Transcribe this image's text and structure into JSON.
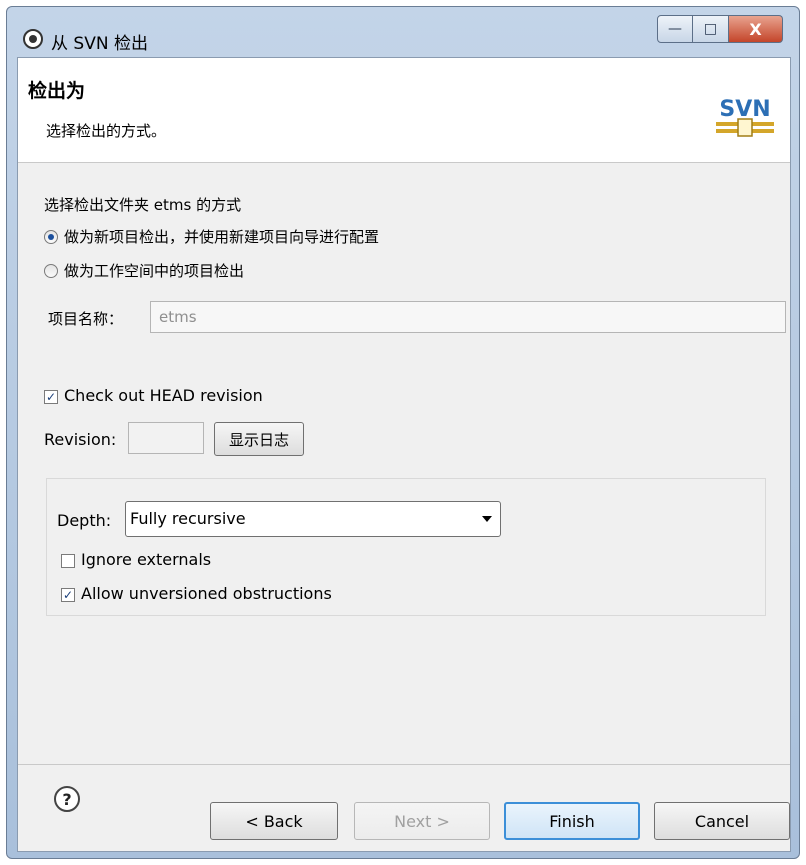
{
  "window": {
    "title": "从 SVN 检出",
    "minimize_glyph": "—",
    "maximize_glyph": "□",
    "close_glyph": "X"
  },
  "banner": {
    "title": "检出为",
    "description": "选择检出的方式。",
    "logo_text": "SVN"
  },
  "checkout": {
    "prompt": "选择检出文件夹 etms 的方式",
    "options": [
      {
        "label": "做为新项目检出，并使用新建项目向导进行配置",
        "selected": true
      },
      {
        "label": "做为工作空间中的项目检出",
        "selected": false
      }
    ],
    "project_name_label": "项目名称：",
    "project_name_value": "etms"
  },
  "revision": {
    "head_label": "Check out HEAD revision",
    "head_checked": true,
    "revision_label": "Revision:",
    "revision_value": "",
    "show_log_label": "显示日志"
  },
  "options": {
    "depth_label": "Depth:",
    "depth_value": "Fully recursive",
    "ignore_externals_label": "Ignore externals",
    "ignore_externals_checked": false,
    "allow_unversioned_label": "Allow unversioned obstructions",
    "allow_unversioned_checked": true
  },
  "footer": {
    "help_glyph": "?",
    "back_label": "< Back",
    "next_label": "Next >",
    "finish_label": "Finish",
    "cancel_label": "Cancel"
  },
  "colors": {
    "default_button_border": "#3c8fd8",
    "svn_logo_blue": "#2c6fb5",
    "svn_logo_gold": "#d4a62a"
  }
}
